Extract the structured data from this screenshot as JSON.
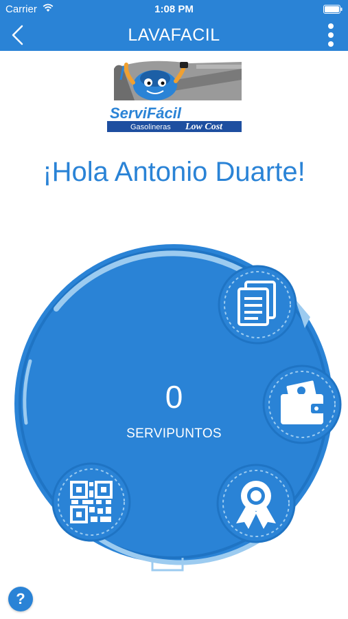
{
  "status_bar": {
    "carrier": "Carrier",
    "time": "1:08 PM"
  },
  "nav": {
    "title": "LAVAFACIL",
    "back_icon": "chevron-left-icon",
    "more_icon": "more-vertical-icon"
  },
  "logo": {
    "line1": "ServiFácil",
    "line2": "Gasolineras",
    "line3": "Low Cost"
  },
  "greeting": "¡Hola Antonio Duarte!",
  "points": {
    "value": "0",
    "label": "SERVIPUNTOS"
  },
  "actions": [
    {
      "id": "documents",
      "icon": "documents-icon"
    },
    {
      "id": "wallet",
      "icon": "wallet-icon"
    },
    {
      "id": "award",
      "icon": "award-ribbon-icon"
    },
    {
      "id": "qr",
      "icon": "qr-code-icon"
    }
  ],
  "help": {
    "label": "?"
  },
  "colors": {
    "primary": "#2a83d6",
    "ring": "#1f74c4",
    "highlight": "#9ccbf0"
  }
}
